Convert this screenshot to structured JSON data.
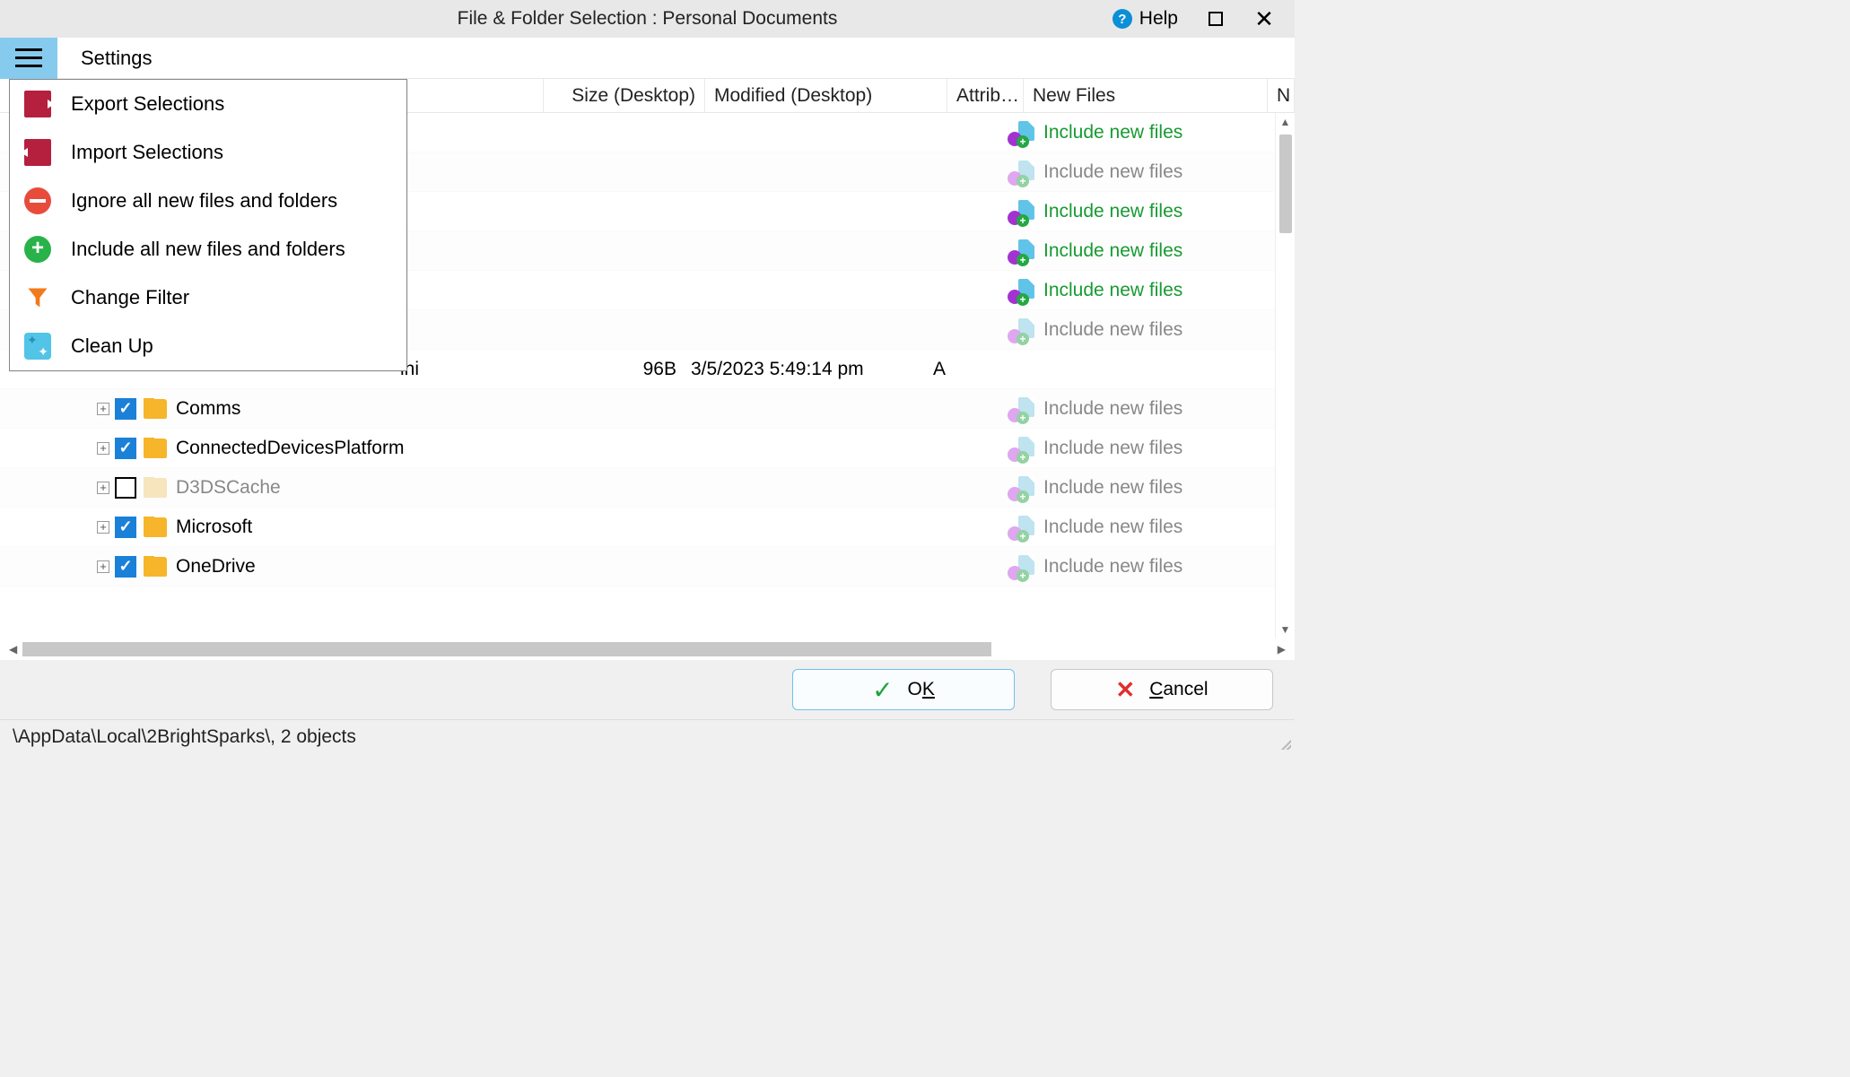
{
  "title": "File & Folder Selection : Personal Documents",
  "titlebar": {
    "help_label": "Help"
  },
  "toolbar": {
    "settings_label": "Settings"
  },
  "menu": {
    "export": "Export Selections",
    "import": "Import Selections",
    "ignore_all": "Ignore all new files and folders",
    "include_all": "Include all new files and folders",
    "change_filter": "Change Filter",
    "clean_up": "Clean Up"
  },
  "columns": {
    "size": "Size (Desktop)",
    "modified": "Modified (Desktop)",
    "attrib_short": "Attrib…",
    "new_files": "New Files",
    "new_folders_partial": "N"
  },
  "new_files_strings": {
    "include": "Include new files"
  },
  "rows": [
    {
      "type": "blank",
      "nf": "include"
    },
    {
      "type": "blank",
      "nf": "dim"
    },
    {
      "type": "blank",
      "nf": "include"
    },
    {
      "type": "blank",
      "nf": "include"
    },
    {
      "type": "blank",
      "nf": "include"
    },
    {
      "type": "blank",
      "nf": "dim"
    },
    {
      "type": "file",
      "name_suffix": "ini",
      "size": "96B",
      "modified": "3/5/2023 5:49:14 pm",
      "attrib": "A"
    },
    {
      "type": "folder",
      "indent": 108,
      "expander": true,
      "checked": true,
      "name": "Comms",
      "nf": "dim"
    },
    {
      "type": "folder",
      "indent": 108,
      "expander": true,
      "checked": true,
      "name": "ConnectedDevicesPlatform",
      "nf": "dim"
    },
    {
      "type": "folder",
      "indent": 108,
      "expander": true,
      "checked": false,
      "dim_folder": true,
      "dim_name": true,
      "name": "D3DSCache",
      "nf": "dim"
    },
    {
      "type": "folder",
      "indent": 108,
      "expander": true,
      "checked": true,
      "name": "Microsoft",
      "nf": "dim"
    },
    {
      "type": "folder",
      "indent": 108,
      "expander": true,
      "checked": true,
      "name": "OneDrive",
      "nf": "dim"
    }
  ],
  "buttons": {
    "ok_prefix": "O",
    "ok_accel": "K",
    "cancel_accel": "C",
    "cancel_suffix": "ancel"
  },
  "status": "\\AppData\\Local\\2BrightSparks\\, 2 objects"
}
